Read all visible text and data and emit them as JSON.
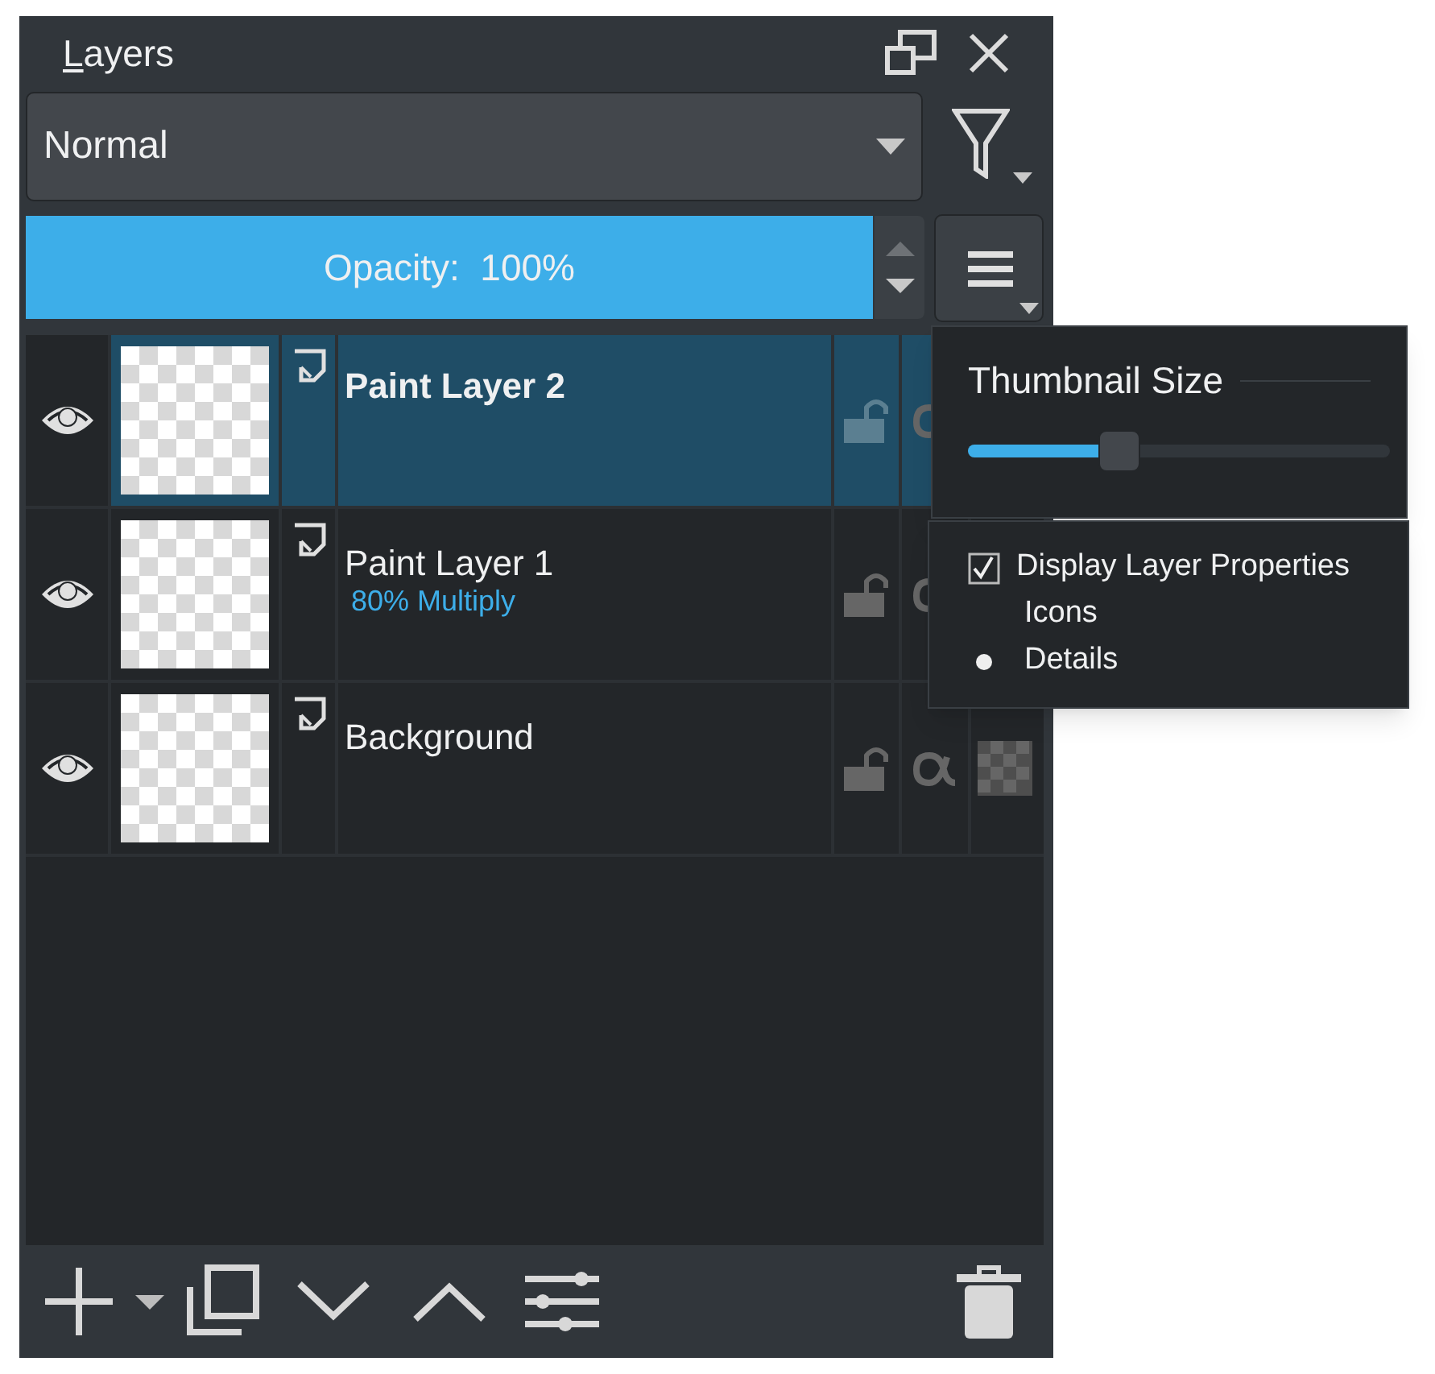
{
  "panel": {
    "title": "Layers",
    "shortcut_underlined": true
  },
  "blend_mode": {
    "value": "Normal"
  },
  "opacity": {
    "label": "Opacity:  100%",
    "level": 1
  },
  "layers": [
    {
      "name": "Paint Layer 2",
      "selected": true,
      "visible": true,
      "locked": false
    },
    {
      "name": "Paint Layer 1",
      "subtitle": "80% Multiply",
      "selected": false,
      "visible": true,
      "locked": false
    },
    {
      "name": "Background",
      "selected": false,
      "visible": true,
      "locked": false,
      "inherit_alpha": true
    }
  ],
  "thumbnail_popup": {
    "title": "Thumbnail Size",
    "level": 0.36
  },
  "view_menu": [
    {
      "kind": "checkbox",
      "label": "Display Layer Properties",
      "checked": true
    },
    {
      "kind": "radio",
      "label": "Icons",
      "selected": false
    },
    {
      "kind": "radio",
      "label": "Details",
      "selected": true
    }
  ]
}
